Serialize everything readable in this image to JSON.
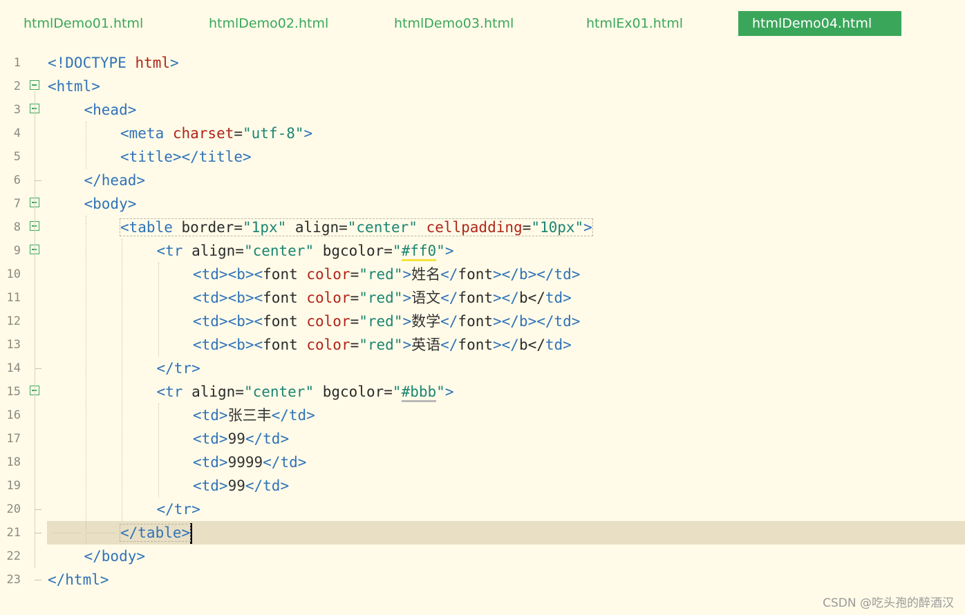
{
  "tabs": [
    {
      "label": "htmlDemo01.html",
      "active": false
    },
    {
      "label": "htmlDemo02.html",
      "active": false
    },
    {
      "label": "htmlDemo03.html",
      "active": false
    },
    {
      "label": "htmlEx01.html",
      "active": false
    },
    {
      "label": "htmlDemo04.html",
      "active": true
    }
  ],
  "accent_color": "#3aa65a",
  "current_line": 21,
  "lines": [
    {
      "n": "1",
      "indent": 0,
      "fold": "none",
      "tokens": [
        [
          "t",
          "<!DOCTYPE "
        ],
        [
          "r",
          "html"
        ],
        [
          "t",
          ">"
        ]
      ]
    },
    {
      "n": "2",
      "indent": 0,
      "fold": "open",
      "tokens": [
        [
          "t",
          "<html>"
        ]
      ]
    },
    {
      "n": "3",
      "indent": 1,
      "fold": "open",
      "tokens": [
        [
          "t",
          "<head>"
        ]
      ]
    },
    {
      "n": "4",
      "indent": 2,
      "fold": "none",
      "tokens": [
        [
          "t",
          "<meta "
        ],
        [
          "r",
          "charset"
        ],
        [
          "a",
          "="
        ],
        [
          "s",
          "\"utf-8\""
        ],
        [
          "t",
          ">"
        ]
      ]
    },
    {
      "n": "5",
      "indent": 2,
      "fold": "none",
      "tokens": [
        [
          "t",
          "<title></title>"
        ]
      ]
    },
    {
      "n": "6",
      "indent": 1,
      "fold": "end",
      "tokens": [
        [
          "t",
          "</head>"
        ]
      ]
    },
    {
      "n": "7",
      "indent": 1,
      "fold": "open",
      "tokens": [
        [
          "t",
          "<body>"
        ]
      ]
    },
    {
      "n": "8",
      "indent": 2,
      "fold": "open",
      "boxed": true,
      "tokens": [
        [
          "t",
          "<table "
        ],
        [
          "a",
          "border"
        ],
        [
          "a",
          "="
        ],
        [
          "s",
          "\"1px\""
        ],
        [
          "a",
          " align"
        ],
        [
          "a",
          "="
        ],
        [
          "s",
          "\"center\""
        ],
        [
          "a",
          " "
        ],
        [
          "r",
          "cellpadding"
        ],
        [
          "a",
          "="
        ],
        [
          "s",
          "\"10px\""
        ],
        [
          "t",
          ">"
        ]
      ]
    },
    {
      "n": "9",
      "indent": 3,
      "fold": "open",
      "tokens": [
        [
          "t",
          "<tr "
        ],
        [
          "a",
          "align"
        ],
        [
          "a",
          "="
        ],
        [
          "s",
          "\"center\""
        ],
        [
          "a",
          " bgcolor"
        ],
        [
          "a",
          "="
        ],
        [
          "s",
          "\""
        ],
        [
          "sy",
          "#ff0"
        ],
        [
          "s",
          "\""
        ],
        [
          "t",
          ">"
        ]
      ]
    },
    {
      "n": "10",
      "indent": 4,
      "fold": "none",
      "tokens": [
        [
          "t",
          "<td><b><"
        ],
        [
          "a",
          "font "
        ],
        [
          "r",
          "color"
        ],
        [
          "a",
          "="
        ],
        [
          "s",
          "\"red\""
        ],
        [
          "t",
          ">"
        ],
        [
          "x",
          "姓名"
        ],
        [
          "t",
          "</"
        ],
        [
          "a",
          "font"
        ],
        [
          "t",
          "></b></td>"
        ]
      ]
    },
    {
      "n": "11",
      "indent": 4,
      "fold": "none",
      "tokens": [
        [
          "t",
          "<td><b><"
        ],
        [
          "a",
          "font "
        ],
        [
          "r",
          "color"
        ],
        [
          "a",
          "="
        ],
        [
          "s",
          "\"red\""
        ],
        [
          "t",
          ">"
        ],
        [
          "x",
          "语文"
        ],
        [
          "t",
          "</"
        ],
        [
          "a",
          "font"
        ],
        [
          "t",
          "></"
        ],
        [
          "a",
          "b</"
        ],
        [
          "t",
          "td>"
        ]
      ]
    },
    {
      "n": "12",
      "indent": 4,
      "fold": "none",
      "tokens": [
        [
          "t",
          "<td><b><"
        ],
        [
          "a",
          "font "
        ],
        [
          "r",
          "color"
        ],
        [
          "a",
          "="
        ],
        [
          "s",
          "\"red\""
        ],
        [
          "t",
          ">"
        ],
        [
          "x",
          "数学"
        ],
        [
          "t",
          "</"
        ],
        [
          "a",
          "font"
        ],
        [
          "t",
          "></b></td>"
        ]
      ]
    },
    {
      "n": "13",
      "indent": 4,
      "fold": "none",
      "tokens": [
        [
          "t",
          "<td><b><"
        ],
        [
          "a",
          "font "
        ],
        [
          "r",
          "color"
        ],
        [
          "a",
          "="
        ],
        [
          "s",
          "\"red\""
        ],
        [
          "t",
          ">"
        ],
        [
          "x",
          "英语"
        ],
        [
          "t",
          "</"
        ],
        [
          "a",
          "font"
        ],
        [
          "t",
          "></"
        ],
        [
          "a",
          "b</"
        ],
        [
          "t",
          "td>"
        ]
      ]
    },
    {
      "n": "14",
      "indent": 3,
      "fold": "end",
      "tokens": [
        [
          "t",
          "</tr>"
        ]
      ]
    },
    {
      "n": "15",
      "indent": 3,
      "fold": "open",
      "tokens": [
        [
          "t",
          "<tr "
        ],
        [
          "a",
          "align"
        ],
        [
          "a",
          "="
        ],
        [
          "s",
          "\"center\""
        ],
        [
          "a",
          " bgcolor"
        ],
        [
          "a",
          "="
        ],
        [
          "s",
          "\""
        ],
        [
          "sg",
          "#bbb"
        ],
        [
          "s",
          "\""
        ],
        [
          "t",
          ">"
        ]
      ]
    },
    {
      "n": "16",
      "indent": 4,
      "fold": "none",
      "tokens": [
        [
          "t",
          "<td>"
        ],
        [
          "x",
          "张三丰"
        ],
        [
          "t",
          "</td>"
        ]
      ]
    },
    {
      "n": "17",
      "indent": 4,
      "fold": "none",
      "tokens": [
        [
          "t",
          "<td>"
        ],
        [
          "x",
          "99"
        ],
        [
          "t",
          "</td>"
        ]
      ]
    },
    {
      "n": "18",
      "indent": 4,
      "fold": "none",
      "tokens": [
        [
          "t",
          "<td>"
        ],
        [
          "x",
          "9999"
        ],
        [
          "t",
          "</td>"
        ]
      ]
    },
    {
      "n": "19",
      "indent": 4,
      "fold": "none",
      "tokens": [
        [
          "t",
          "<td>"
        ],
        [
          "x",
          "99"
        ],
        [
          "t",
          "</td>"
        ]
      ]
    },
    {
      "n": "20",
      "indent": 3,
      "fold": "end",
      "tokens": [
        [
          "t",
          "</tr>"
        ]
      ]
    },
    {
      "n": "21",
      "indent": 2,
      "fold": "end",
      "current": true,
      "boxed": true,
      "tokens": [
        [
          "t",
          "</table>"
        ]
      ]
    },
    {
      "n": "22",
      "indent": 1,
      "fold": "none",
      "tokens": [
        [
          "t",
          "</body>"
        ]
      ]
    },
    {
      "n": "23",
      "indent": 0,
      "fold": "end",
      "tokens": [
        [
          "t",
          "</html>"
        ]
      ]
    }
  ],
  "watermark": "CSDN @吃头孢的醉酒汉"
}
